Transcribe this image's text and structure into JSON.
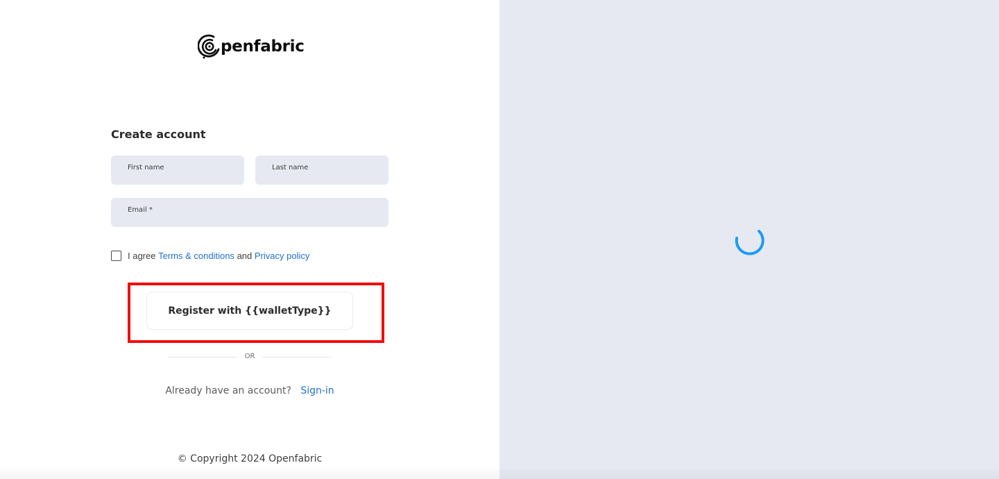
{
  "brand": {
    "name": "penfabric",
    "logo_icon": "openfabric-logo-icon"
  },
  "form": {
    "title": "Create account",
    "first_name": {
      "label": "First name",
      "value": ""
    },
    "last_name": {
      "label": "Last name",
      "value": ""
    },
    "email": {
      "label": "Email *",
      "value": ""
    },
    "agree": {
      "checked": false,
      "prefix": "I agree",
      "terms_link": "Terms & conditions",
      "conjunction": "and",
      "privacy_link": "Privacy policy"
    },
    "register_label": "Register with {{walletType}}",
    "or_label": "OR",
    "signin_prompt": "Already have an account?",
    "signin_link": "Sign-in"
  },
  "footer": {
    "copyright": "© Copyright 2024 Openfabric"
  },
  "right_panel": {
    "state": "loading",
    "spinner_icon": "loading-spinner-icon"
  },
  "colors": {
    "accent_link": "#1f6fd1",
    "field_bg": "#e6e9f1",
    "right_panel_bg": "#e6e9f2",
    "highlight": "#f20d0d",
    "spinner": "#1a9df2"
  }
}
